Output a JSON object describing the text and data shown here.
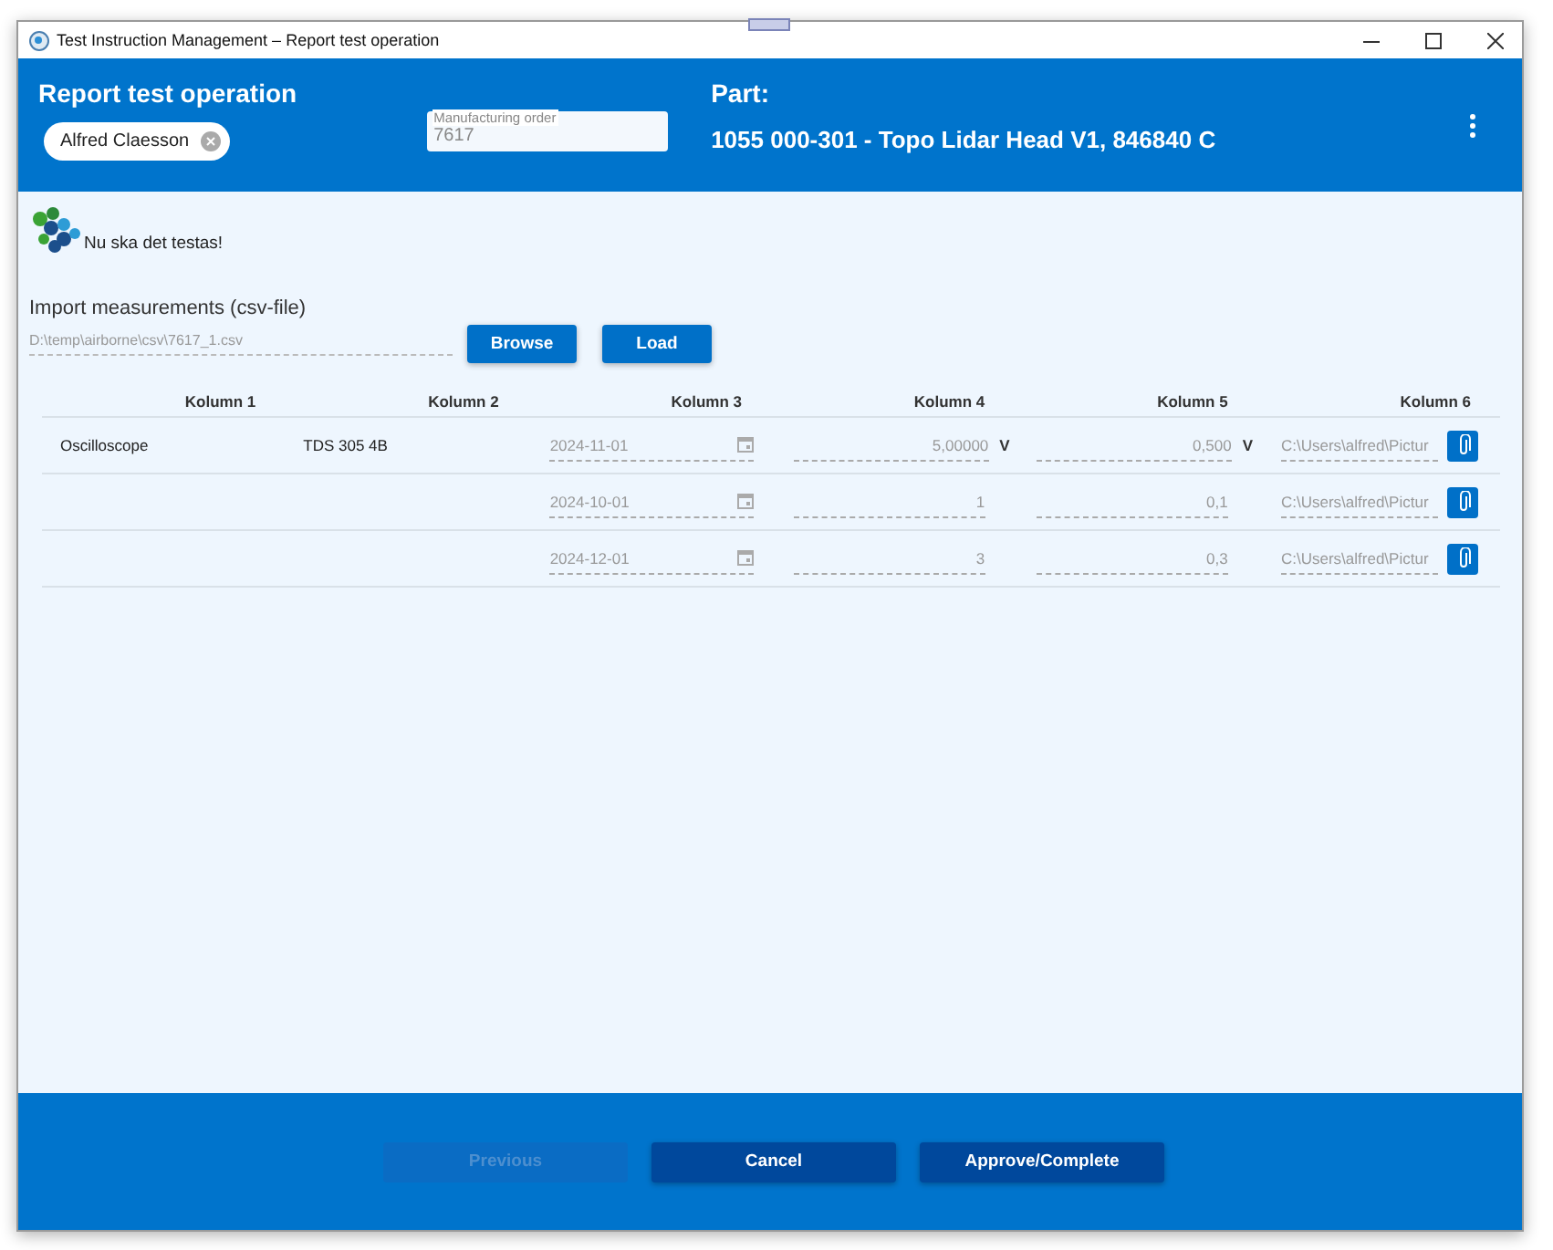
{
  "window": {
    "title": "Test Instruction Management – Report test operation"
  },
  "header": {
    "title": "Report test operation",
    "operator": "Alfred Claesson",
    "order_field": {
      "label": "Manufacturing order",
      "value": "7617"
    },
    "part_label": "Part:",
    "part_value": "1055 000-301 - Topo Lidar Head V1, 846840 C"
  },
  "instruction": "Nu ska det testas!",
  "import": {
    "label": "Import measurements (csv-file)",
    "path": "D:\\temp\\airborne\\csv\\7617_1.csv",
    "buttons": [
      "Browse",
      "Load"
    ]
  },
  "table": {
    "columns": [
      "Kolumn 1",
      "Kolumn 2",
      "Kolumn 3",
      "Kolumn 4",
      "Kolumn 5",
      "Kolumn 6"
    ],
    "rows": [
      {
        "cells": [
          {
            "kind": "text",
            "text": "Oscilloscope"
          },
          {
            "kind": "text",
            "text": "TDS 305 4B"
          },
          {
            "kind": "date",
            "value": "2024-11-01"
          },
          {
            "kind": "number",
            "value": "5,00000",
            "unit": "V"
          },
          {
            "kind": "number",
            "value": "0,500",
            "unit": "V"
          },
          {
            "kind": "file",
            "value": "C:\\Users\\alfred\\Pictur"
          }
        ]
      },
      {
        "cells": [
          {
            "kind": "blank"
          },
          {
            "kind": "blank"
          },
          {
            "kind": "date",
            "value": "2024-10-01"
          },
          {
            "kind": "number",
            "value": "1"
          },
          {
            "kind": "number",
            "value": "0,1"
          },
          {
            "kind": "file",
            "value": "C:\\Users\\alfred\\Pictur"
          }
        ]
      },
      {
        "cells": [
          {
            "kind": "blank"
          },
          {
            "kind": "blank"
          },
          {
            "kind": "date",
            "value": "2024-12-01"
          },
          {
            "kind": "number",
            "value": "3"
          },
          {
            "kind": "number",
            "value": "0,3"
          },
          {
            "kind": "file",
            "value": "C:\\Users\\alfred\\Pictur"
          }
        ]
      }
    ]
  },
  "footer": {
    "buttons": [
      {
        "label": "Previous",
        "disabled": true
      },
      {
        "label": "Cancel",
        "disabled": false
      },
      {
        "label": "Approve/Complete",
        "disabled": false
      }
    ]
  }
}
